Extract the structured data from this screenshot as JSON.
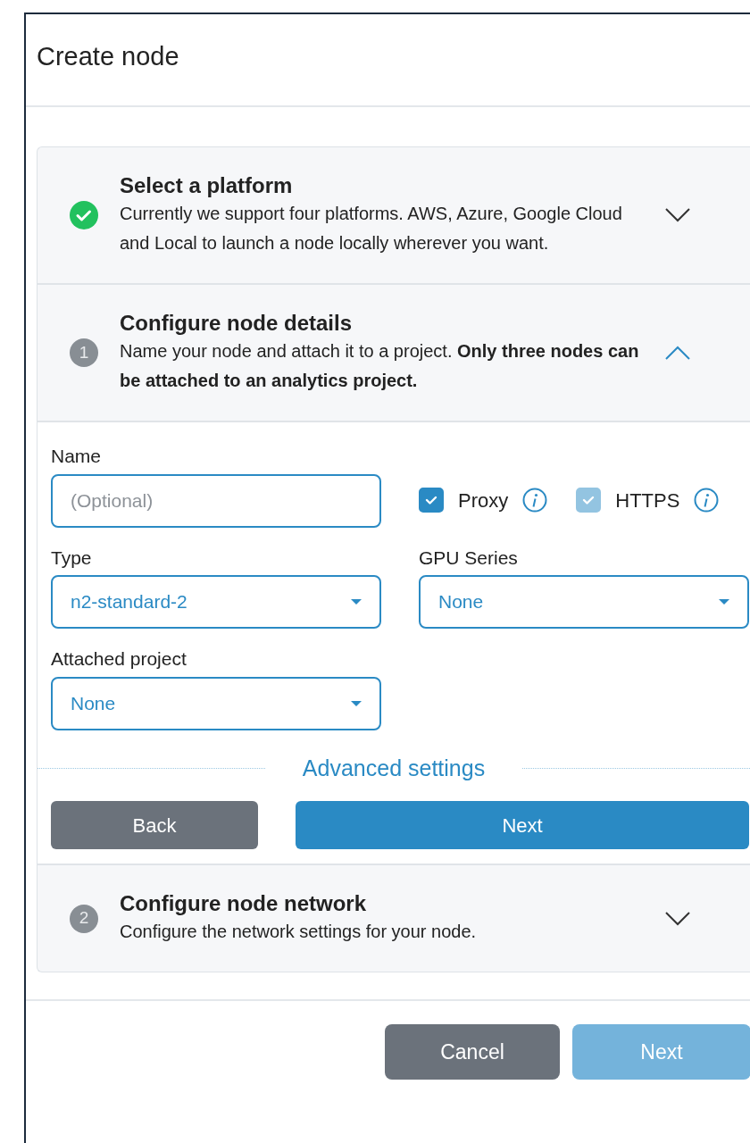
{
  "modal": {
    "title": "Create node"
  },
  "steps": [
    {
      "kind": "done",
      "title": "Select a platform",
      "description": "Currently we support four platforms. AWS, Azure, Google Cloud and Local to launch a node locally wherever you want.",
      "expanded": false
    },
    {
      "kind": "numbered",
      "number": "1",
      "title": "Configure node details",
      "description": "Name your node and attach it to a project. **Only three nodes can be attached to an analytics project.**",
      "expanded": true
    },
    {
      "kind": "numbered",
      "number": "2",
      "title": "Configure node network",
      "description": "Configure the network settings for your node.",
      "expanded": false
    }
  ],
  "form": {
    "name": {
      "label": "Name",
      "placeholder": "(Optional)"
    },
    "checkboxes": [
      {
        "label": "Proxy",
        "checked": true,
        "disabled": false
      },
      {
        "label": "HTTPS",
        "checked": true,
        "disabled": true
      }
    ],
    "selects": [
      {
        "label": "Type",
        "value": "n2-standard-2"
      },
      {
        "label": "GPU Series",
        "value": "None"
      },
      {
        "label": "Attached project",
        "value": "None"
      }
    ],
    "advanced_link": "Advanced settings",
    "back_button": "Back",
    "next_button": "Next"
  },
  "footer": {
    "cancel_button": "Cancel",
    "next_button": {
      "label": "Next",
      "disabled": true
    }
  }
}
